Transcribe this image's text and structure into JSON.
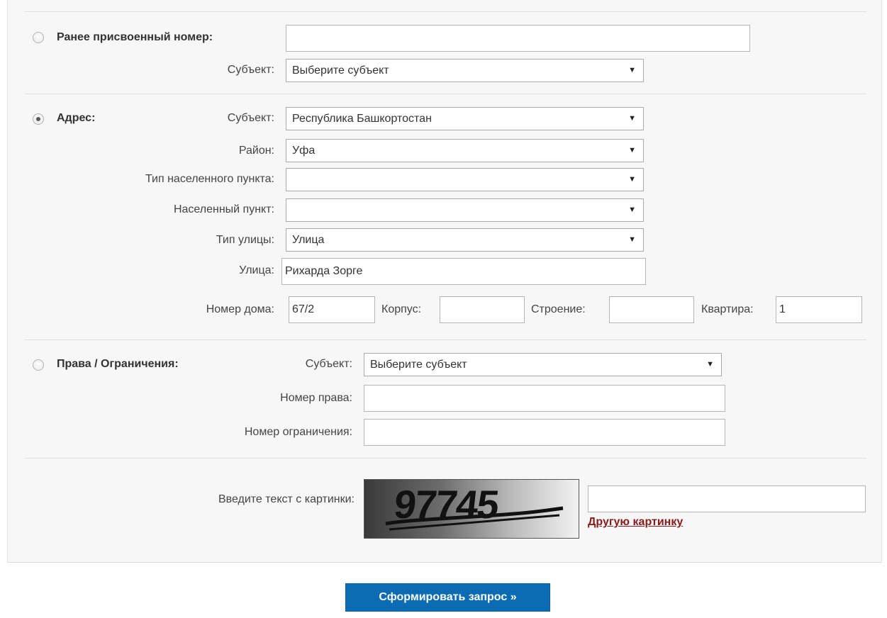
{
  "prev_number": {
    "title": "Ранее присвоенный номер:",
    "value": "",
    "subject_label": "Субъект:",
    "subject_value": "Выберите субъект"
  },
  "address": {
    "title": "Адрес:",
    "subject_label": "Субъект:",
    "subject_value": "Республика Башкортостан",
    "district_label": "Район:",
    "district_value": "Уфа",
    "locality_type_label": "Тип населенного пункта:",
    "locality_type_value": "",
    "locality_label": "Населенный пункт:",
    "locality_value": "",
    "street_type_label": "Тип улицы:",
    "street_type_value": "Улица",
    "street_label": "Улица:",
    "street_value": "Рихарда Зорге",
    "house_label": "Номер дома:",
    "house_value": "67/2",
    "building_label": "Корпус:",
    "building_value": "",
    "structure_label": "Строение:",
    "structure_value": "",
    "apartment_label": "Квартира:",
    "apartment_value": "1"
  },
  "rights": {
    "title": "Права / Ограничения:",
    "subject_label": "Субъект:",
    "subject_value": "Выберите субъект",
    "right_number_label": "Номер права:",
    "right_number_value": "",
    "restriction_number_label": "Номер ограничения:",
    "restriction_number_value": ""
  },
  "captcha": {
    "label": "Введите текст с картинки:",
    "image_text": "97745",
    "value": "",
    "refresh_link": "Другую картинку"
  },
  "submit_label": "Сформировать запрос »",
  "colors": {
    "submit_bg": "#0b6cb3",
    "link": "#8a1b1b",
    "panel_bg": "#f7f7f7"
  }
}
